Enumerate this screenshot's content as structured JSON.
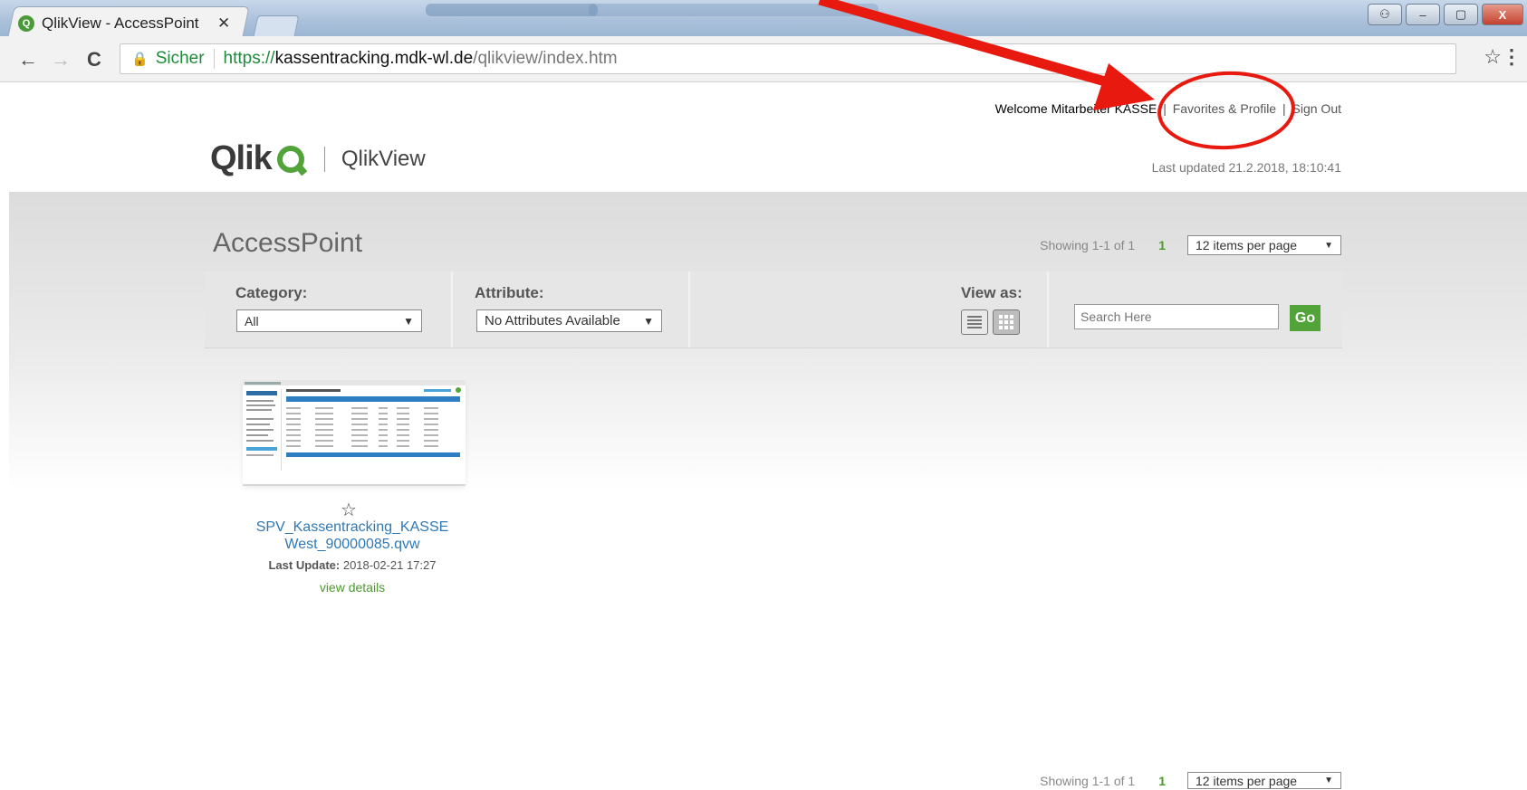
{
  "browser": {
    "tab_title": "QlikView - AccessPoint",
    "tab_close": "✕",
    "favicon_letter": "Q",
    "window_buttons": [
      "⚇",
      "–",
      "▢",
      "X"
    ],
    "nav": {
      "back": "←",
      "forward": "→",
      "reload": "C"
    },
    "address": {
      "secure_label": "Sicher",
      "scheme": "https://",
      "host": "kassentracking.mdk-wl.de",
      "path": "/qlikview/index.htm"
    },
    "bookmark_star": "☆",
    "menu_dots": "⋮"
  },
  "header": {
    "welcome": "Welcome Mitarbeiter KASSE",
    "favorites_link": "Favorites & Profile",
    "signout_link": "Sign Out",
    "separator": "|",
    "logo_text": "Qlik",
    "product_text": "QlikView",
    "last_updated": "Last updated 21.2.2018, 18:10:41"
  },
  "main": {
    "title": "AccessPoint",
    "pager_top": {
      "showing": "Showing 1-1 of 1",
      "page": "1",
      "per_page": "12 items per page",
      "arrow": "▼"
    },
    "pager_bottom": {
      "showing": "Showing 1-1 of 1",
      "page": "1",
      "per_page": "12 items per page",
      "arrow": "▼"
    }
  },
  "filters": {
    "category_label": "Category:",
    "category_value": "All",
    "attribute_label": "Attribute:",
    "attribute_value": "No Attributes Available",
    "view_as_label": "View as:",
    "search_placeholder": "Search Here",
    "go_label": "Go"
  },
  "documents": [
    {
      "star": "☆",
      "name_line1": "SPV_Kassentracking_KASSE",
      "name_line2": "West_90000085.qvw",
      "last_update_label": "Last Update:",
      "last_update_value": "2018-02-21 17:27",
      "details_link": "view details"
    }
  ],
  "colors": {
    "qlik_green": "#52a33a",
    "link_blue": "#2f78b5",
    "annotation_red": "#e8190f"
  },
  "annotation": {
    "shapes": [
      "red-arrow",
      "red-circle"
    ]
  }
}
